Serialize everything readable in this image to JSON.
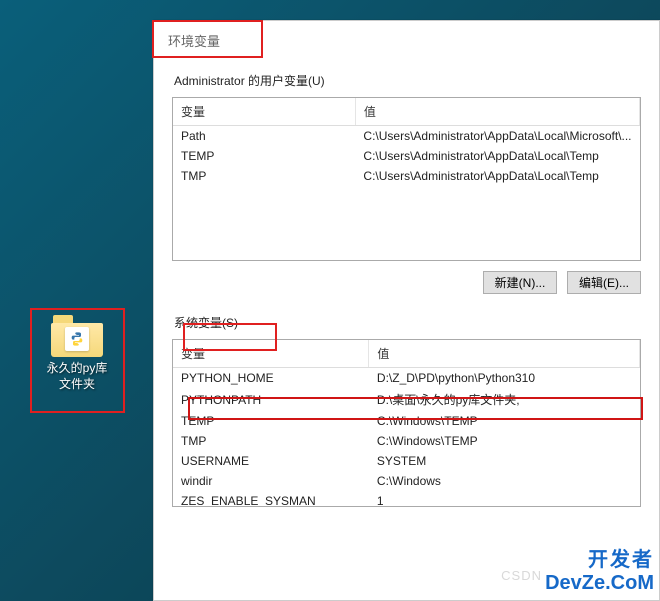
{
  "desktop": {
    "folder_label": "永久的py库\n文件夹"
  },
  "dialog": {
    "title": "环境变量",
    "user_section_label": "Administrator 的用户变量(U)",
    "system_section_label": "系统变量(S)",
    "col_var": "变量",
    "col_val": "值",
    "user_vars": [
      {
        "name": "Path",
        "value": "C:\\Users\\Administrator\\AppData\\Local\\Microsoft\\..."
      },
      {
        "name": "TEMP",
        "value": "C:\\Users\\Administrator\\AppData\\Local\\Temp"
      },
      {
        "name": "TMP",
        "value": "C:\\Users\\Administrator\\AppData\\Local\\Temp"
      }
    ],
    "system_vars": [
      {
        "name": "PYTHON_HOME",
        "value": "D:\\Z_D\\PD\\python\\Python310"
      },
      {
        "name": "PYTHONPATH",
        "value": "D:\\桌面\\永久的py库文件夹;"
      },
      {
        "name": "TEMP",
        "value": "C:\\Windows\\TEMP"
      },
      {
        "name": "TMP",
        "value": "C:\\Windows\\TEMP"
      },
      {
        "name": "USERNAME",
        "value": "SYSTEM"
      },
      {
        "name": "windir",
        "value": "C:\\Windows"
      },
      {
        "name": "ZES_ENABLE_SYSMAN",
        "value": "1"
      }
    ],
    "buttons": {
      "new": "新建(N)...",
      "edit": "编辑(E)..."
    }
  },
  "watermark": {
    "line1": "开发者",
    "line2": "DevZe.CoM",
    "csdn": "CSDN"
  }
}
